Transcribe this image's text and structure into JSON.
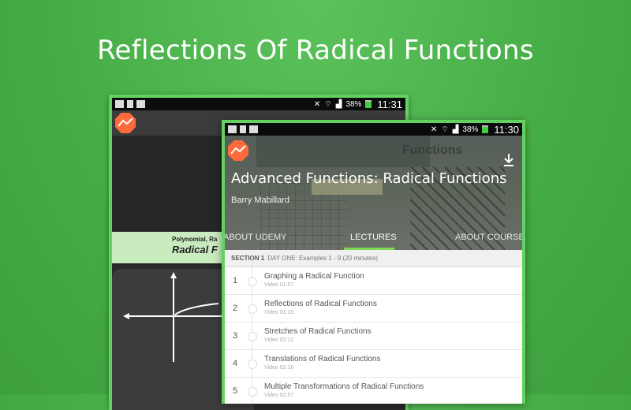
{
  "headline": "Reflections Of Radical Functions",
  "back_screen": {
    "status": {
      "battery": "38%",
      "time": "11:31"
    },
    "subtitle": "Polynomial, Ra",
    "title": "Radical F"
  },
  "front_screen": {
    "status": {
      "battery": "38%",
      "time": "11:30"
    },
    "hero_text": "Functions",
    "course_title": "Advanced Functions: Radical Functions",
    "instructor": "Barry Mabillard",
    "tabs": [
      "ABOUT UDEMY",
      "LECTURES",
      "ABOUT COURSE"
    ],
    "active_tab": "LECTURES",
    "section": {
      "label": "SECTION 1",
      "name": "DAY ONE: Examples 1 - 9 (20 minutes)"
    },
    "lectures": [
      {
        "num": "1",
        "title": "Graphing a Radical Function",
        "meta": "Video 01:57"
      },
      {
        "num": "2",
        "title": "Reflections of Radical Functions",
        "meta": "Video 01:15"
      },
      {
        "num": "3",
        "title": "Stretches of Radical Functions",
        "meta": "Video 02:12"
      },
      {
        "num": "4",
        "title": "Translations of Radical Functions",
        "meta": "Video 02:16"
      },
      {
        "num": "5",
        "title": "Multiple Transformations of Radical Functions",
        "meta": "Video 02:57"
      }
    ]
  },
  "colors": {
    "accent": "#62d362",
    "tab_underline": "#7ed957",
    "logo": "#ff6a3d"
  },
  "icons": [
    "logo-icon",
    "download-icon",
    "wifi-icon",
    "signal-icon",
    "battery-icon"
  ]
}
